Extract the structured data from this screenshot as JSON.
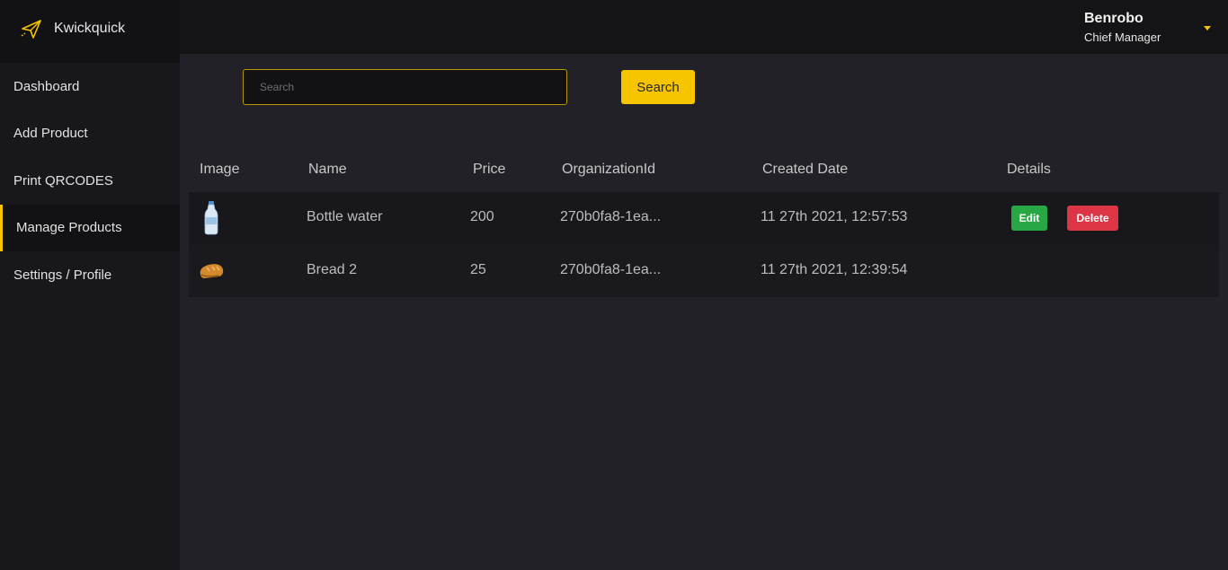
{
  "brand": {
    "name": "Kwickquick",
    "icon": "paper-plane-icon",
    "accent": "#f7c500"
  },
  "sidebar": {
    "items": [
      {
        "label": "Dashboard"
      },
      {
        "label": "Add Product"
      },
      {
        "label": "Print QRCODES"
      },
      {
        "label": "Manage Products",
        "active": true
      },
      {
        "label": "Settings / Profile"
      }
    ]
  },
  "user": {
    "name": "Benrobo",
    "role": "Chief Manager"
  },
  "search": {
    "placeholder": "Search",
    "value": "",
    "button_label": "Search"
  },
  "table": {
    "headers": [
      "Image",
      "Name",
      "Price",
      "OrganizationId",
      "Created Date",
      "Details"
    ],
    "rows": [
      {
        "image": "water-bottle-image",
        "name": "Bottle water",
        "price": "200",
        "org_id": "270b0fa8-1ea...",
        "created": "11 27th 2021, 12:57:53",
        "actions": {
          "edit": "Edit",
          "delete": "Delete"
        }
      },
      {
        "image": "bread-image",
        "name": "Bread 2",
        "price": "25",
        "org_id": "270b0fa8-1ea...",
        "created": "11 27th 2021, 12:39:54"
      }
    ]
  },
  "colors": {
    "edit": "#28a745",
    "delete": "#dc3545",
    "background": "#222127"
  }
}
